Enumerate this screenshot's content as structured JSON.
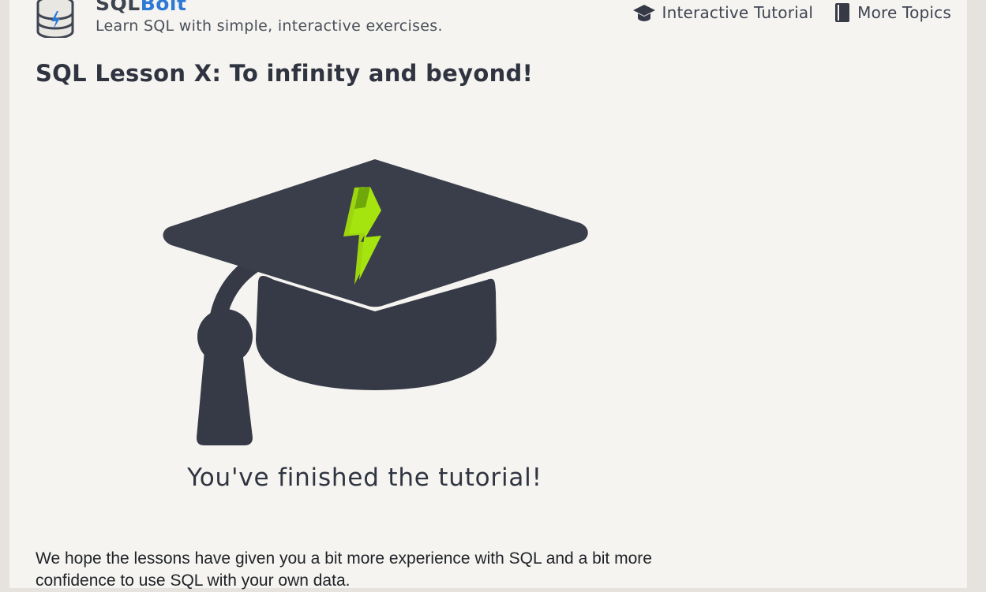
{
  "header": {
    "brand_part1": "SQL",
    "brand_part2": "Bolt",
    "tagline": "Learn SQL with simple, interactive exercises."
  },
  "nav": {
    "items": [
      {
        "label": "Interactive Tutorial",
        "icon": "graduation-cap-icon"
      },
      {
        "label": "More Topics",
        "icon": "book-icon"
      }
    ]
  },
  "lesson": {
    "title": "SQL Lesson X: To infinity and beyond!",
    "finished_message": "You've finished the tutorial!",
    "body": "We hope the lessons have given you a bit more experience with SQL and a bit more confidence to use SQL with your own data."
  },
  "colors": {
    "brand_accent": "#2d7ad6",
    "cap": "#363a46",
    "bolt": "#a6e40f"
  }
}
